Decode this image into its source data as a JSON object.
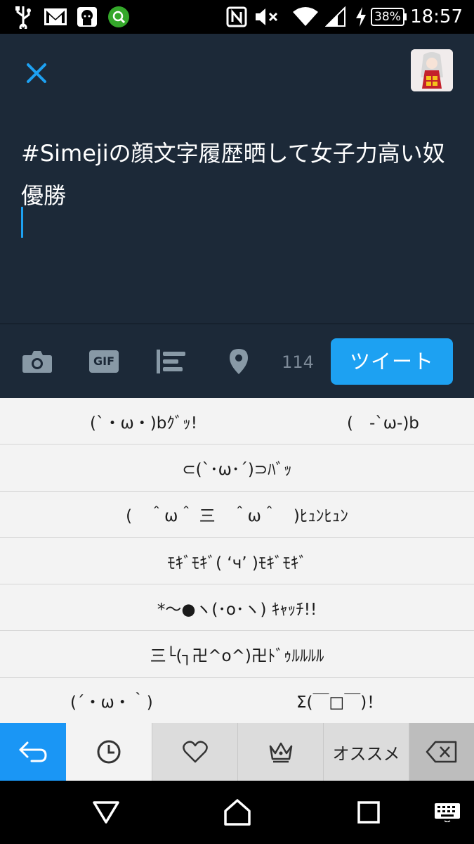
{
  "status_bar": {
    "time": "18:57",
    "battery": "38%",
    "icons": [
      "usb-icon",
      "gmail-icon",
      "app-notification-icon",
      "search-app-icon",
      "nfc-icon",
      "mute-icon",
      "wifi-icon",
      "signal-icon",
      "charging-icon",
      "battery-icon"
    ]
  },
  "compose": {
    "close_icon": "close-icon",
    "tweet_text": "#Simejiの顔文字履歴晒して女子力高い奴優勝"
  },
  "toolbar": {
    "icons": [
      "camera-icon",
      "gif-icon",
      "poll-icon",
      "location-icon"
    ],
    "gif_label": "GIF",
    "char_count": "114",
    "tweet_label": "ツイート"
  },
  "kaomoji": {
    "rows": [
      [
        "(`・ω・)bｸﾞｯ!",
        "(　-`ω-)b"
      ],
      [
        "⊂(`･ω･´)⊃ﾊﾞｯ"
      ],
      [
        "(　＾ω＾ 三　＾ω＾　)ﾋｭﾝﾋｭﾝ"
      ],
      [
        "ﾓｷﾞﾓｷﾞ( ‘ч’ )ﾓｷﾞﾓｷﾞ"
      ],
      [
        "*〜●ヽ(･o･ヽ) ｷｬｯﾁ!!"
      ],
      [
        "三└(┐卍^o^)卍ﾄﾞｩﾙﾙﾙﾙ"
      ],
      [
        "(´・ω・｀)",
        "Σ(￣□￣)！"
      ]
    ]
  },
  "keyboard_tabs": {
    "osusume_label": "オススメ",
    "icons": [
      "back-arrow-icon",
      "clock-icon",
      "heart-icon",
      "crown-icon",
      "backspace-icon"
    ]
  },
  "nav_bar": {
    "icons": [
      "back-triangle-icon",
      "home-icon",
      "recents-icon",
      "keyboard-icon"
    ]
  },
  "colors": {
    "compose_bg": "#1c2938",
    "accent": "#1da1f2",
    "keyboard_bg": "#f3f3f3"
  }
}
